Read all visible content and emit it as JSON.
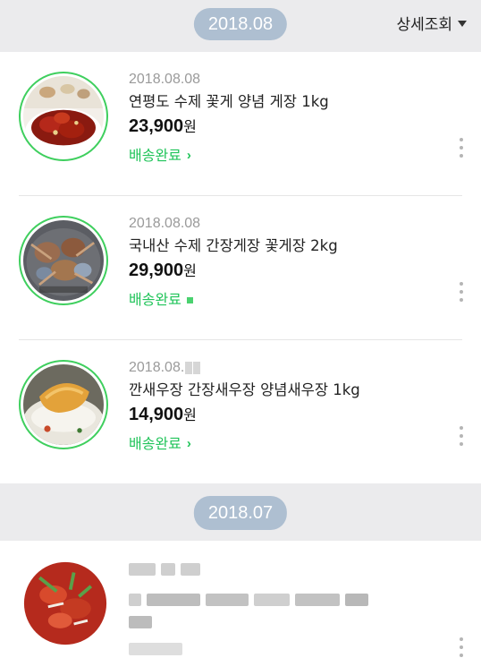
{
  "header": {
    "month": "2018.08",
    "detail_label": "상세조회"
  },
  "orders": [
    {
      "date": "2018.08.08",
      "name": "연평도 수제 꽃게 양념 게장 1kg",
      "price": "23,900",
      "currency": "원",
      "status": "배송완료",
      "status_marker": "chevron-right-icon"
    },
    {
      "date": "2018.08.08",
      "name": "국내산 수제 간장게장 꽃게장 2kg",
      "price": "29,900",
      "currency": "원",
      "status": "배송완료",
      "status_marker": "square-icon"
    },
    {
      "date": "2018.08.",
      "name": "깐새우장 간장새우장 양념새우장 1kg",
      "price": "14,900",
      "currency": "원",
      "status": "배송완료",
      "status_marker": "chevron-right-icon"
    }
  ],
  "section2": {
    "month": "2018.07"
  },
  "colors": {
    "pill": "#aebfd1",
    "status_green": "#21c45a",
    "ring_green": "#3fcf5e",
    "background": "#ebebed"
  }
}
